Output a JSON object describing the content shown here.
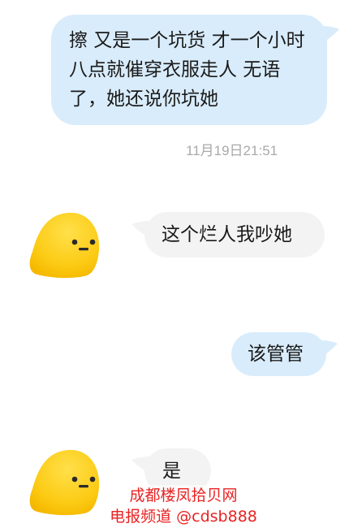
{
  "messages": [
    {
      "id": "m1",
      "side": "out",
      "text": "擦 又是一个坑货 才一个小时八点就催穿衣服走人 无语了，她还说你坑她"
    },
    {
      "id": "m2",
      "side": "in",
      "text": "这个烂人我吵她"
    },
    {
      "id": "m3",
      "side": "out",
      "text": "该管管"
    },
    {
      "id": "m4",
      "side": "in",
      "text": "是"
    }
  ],
  "timestamp": "11月19日21:51",
  "avatar_icon": "yellow-blob-emoji-icon",
  "watermark": {
    "line1": "成都楼凤拾贝网",
    "line2": "电报频道 @cdsb888"
  },
  "colors": {
    "outgoing_bubble": "#d9ecfb",
    "incoming_bubble": "#f3f3f3",
    "avatar_yellow": "#fcd01c",
    "watermark_red": "#ea2222",
    "timestamp_gray": "#a9a9a9"
  }
}
